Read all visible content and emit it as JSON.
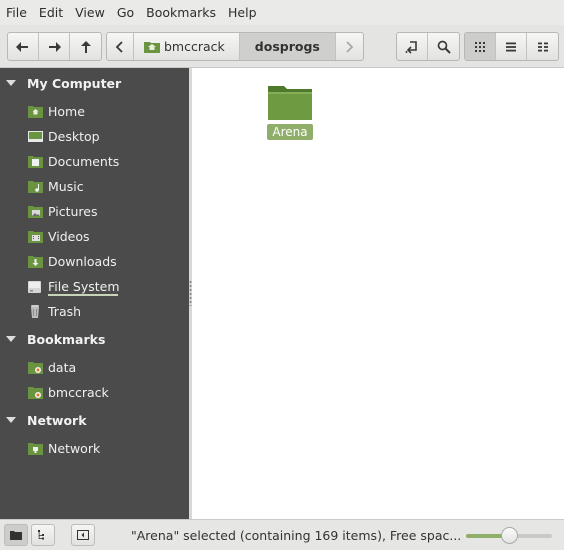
{
  "menu": [
    "File",
    "Edit",
    "View",
    "Go",
    "Bookmarks",
    "Help"
  ],
  "toolbar": {
    "back_icon": "arrow-left-icon",
    "forward_icon": "arrow-right-icon",
    "up_icon": "arrow-up-icon",
    "breadcrumb_prev_icon": "chevron-left-icon",
    "breadcrumb_next_icon": "chevron-right-icon",
    "breadcrumbs": [
      "bmccrack",
      "dosprogs"
    ],
    "toggle_location_icon": "location-toggle-icon",
    "search_icon": "search-icon",
    "view_icons": [
      "icon-view-icon",
      "list-view-icon",
      "compact-view-icon"
    ],
    "active_view": "icon-view-icon"
  },
  "sidebar": {
    "sections": [
      {
        "title": "My Computer",
        "items": [
          {
            "label": "Home",
            "icon": "home-folder-icon"
          },
          {
            "label": "Desktop",
            "icon": "desktop-icon"
          },
          {
            "label": "Documents",
            "icon": "documents-folder-icon"
          },
          {
            "label": "Music",
            "icon": "music-folder-icon"
          },
          {
            "label": "Pictures",
            "icon": "pictures-folder-icon"
          },
          {
            "label": "Videos",
            "icon": "videos-folder-icon"
          },
          {
            "label": "Downloads",
            "icon": "downloads-folder-icon"
          },
          {
            "label": "File System",
            "icon": "drive-icon"
          },
          {
            "label": "Trash",
            "icon": "trash-icon"
          }
        ]
      },
      {
        "title": "Bookmarks",
        "items": [
          {
            "label": "data",
            "icon": "bookmark-folder-icon"
          },
          {
            "label": "bmccrack",
            "icon": "bookmark-folder-icon"
          }
        ]
      },
      {
        "title": "Network",
        "items": [
          {
            "label": "Network",
            "icon": "network-icon"
          }
        ]
      }
    ],
    "file_system_usage": 0.9
  },
  "files": [
    {
      "name": "Arena",
      "type": "folder",
      "selected": true
    }
  ],
  "status": {
    "text": "\"Arena\" selected (containing 169 items), Free spac...",
    "zoom_level": 0.5
  },
  "colors": {
    "accent": "#8fae6a",
    "folder": "#5f8a36",
    "sidebar_bg": "#4b4b4b"
  }
}
